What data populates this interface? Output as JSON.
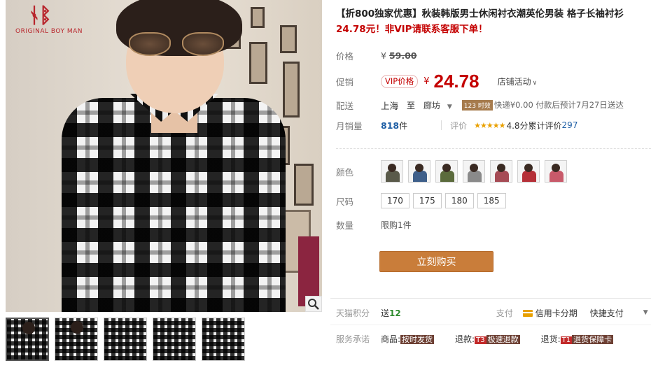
{
  "brand": {
    "logo_mark": "ᛀᛔ",
    "logo_text": "ORIGINAL BOY MAN"
  },
  "product": {
    "title": "【折800独家优惠】秋装韩版男士休闲衬衣潮英伦男装 格子长袖衬衫",
    "subtitle": "24.78元！非VIP请联系客服下单！"
  },
  "price": {
    "label": "价格",
    "currency": "¥",
    "original": "59.00"
  },
  "promo": {
    "label": "促销",
    "vip_tag": "VIP价格",
    "currency": "¥",
    "current": "24.78",
    "shop_activity": "店铺活动",
    "chevron": "∨"
  },
  "shipping": {
    "label": "配送",
    "from": "上海",
    "to_word": "至",
    "dest": "廊坊",
    "dest_caret": "▼",
    "fast_badge": "123 时效",
    "text": "快递¥0.00 付款后预计7月27日送达"
  },
  "sales": {
    "label": "月销量",
    "count": "818",
    "unit": "件",
    "rating_label": "评价",
    "stars": "★★★★★",
    "score_text": "4.8分",
    "total_label": "累计评价",
    "total_count": "297"
  },
  "color": {
    "label": "颜色",
    "swatches": [
      {
        "name": "color-1",
        "color": "#5a5a4a"
      },
      {
        "name": "color-2",
        "color": "#3e5f8a"
      },
      {
        "name": "color-3",
        "color": "#5b6b3c"
      },
      {
        "name": "color-4",
        "color": "#8a8a8a"
      },
      {
        "name": "color-5",
        "color": "#a64b55"
      },
      {
        "name": "color-6",
        "color": "#b53038"
      },
      {
        "name": "color-7",
        "color": "#c85a6a"
      }
    ]
  },
  "size": {
    "label": "尺码",
    "options": [
      "170",
      "175",
      "180",
      "185"
    ]
  },
  "quantity": {
    "label": "数量",
    "text": "限购1件"
  },
  "buy_button": "立刻购买",
  "points": {
    "label": "天猫积分",
    "give": "送",
    "amount": "12"
  },
  "payment": {
    "label": "支付",
    "option1": "信用卡分期",
    "option2": "快捷支付",
    "caret": "▼"
  },
  "service": {
    "label": "服务承诺",
    "items": [
      {
        "prefix": "商品:",
        "code": "",
        "tag": "按时发货"
      },
      {
        "prefix": "退款:",
        "code": "T3",
        "tag": "极速退款"
      },
      {
        "prefix": "退货:",
        "code": "T1",
        "tag": "退货保障卡"
      }
    ]
  },
  "colors": {
    "accent_red": "#c40000",
    "buy_button": "#c97d3a",
    "link_blue": "#1f5fa5"
  }
}
